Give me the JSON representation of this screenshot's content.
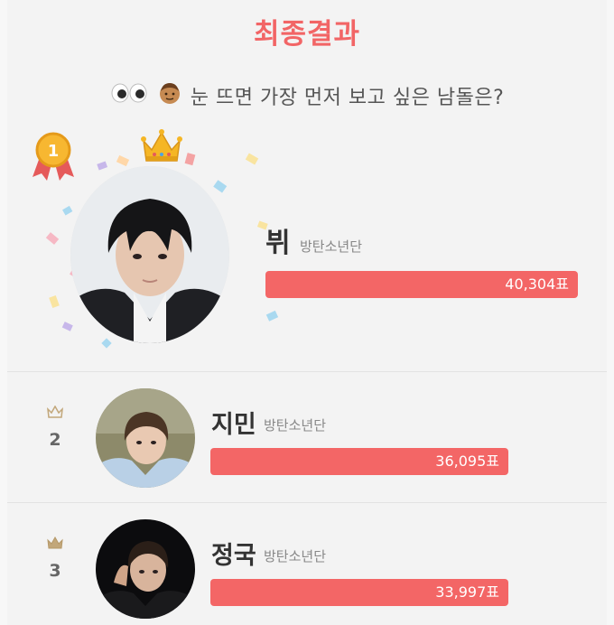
{
  "header": {
    "title": "최종결과"
  },
  "question": {
    "text": "눈 뜨면 가장 먼저 보고 싶은 남돌은?",
    "emoji_icons": [
      "eyes-icon",
      "boy-face-icon"
    ]
  },
  "results": [
    {
      "rank": "1",
      "name": "뷔",
      "group": "방탄소년단",
      "votes_label": "40,304표",
      "votes": 40304,
      "bar_fill": 0.88,
      "medal_icon": "gold-medal-icon",
      "crown_icon": "crown-icon"
    },
    {
      "rank": "2",
      "name": "지민",
      "group": "방탄소년단",
      "votes_label": "36,095표",
      "votes": 36095,
      "bar_fill": 0.78,
      "crown_icon": "small-crown-icon"
    },
    {
      "rank": "3",
      "name": "정국",
      "group": "방탄소년단",
      "votes_label": "33,997표",
      "votes": 33997,
      "bar_fill": 0.78,
      "crown_icon": "small-crown-icon"
    }
  ],
  "colors": {
    "accent": "#f26566",
    "bar": "#f36666",
    "background": "#f3f3f3",
    "text": "#333333",
    "muted": "#888888"
  }
}
